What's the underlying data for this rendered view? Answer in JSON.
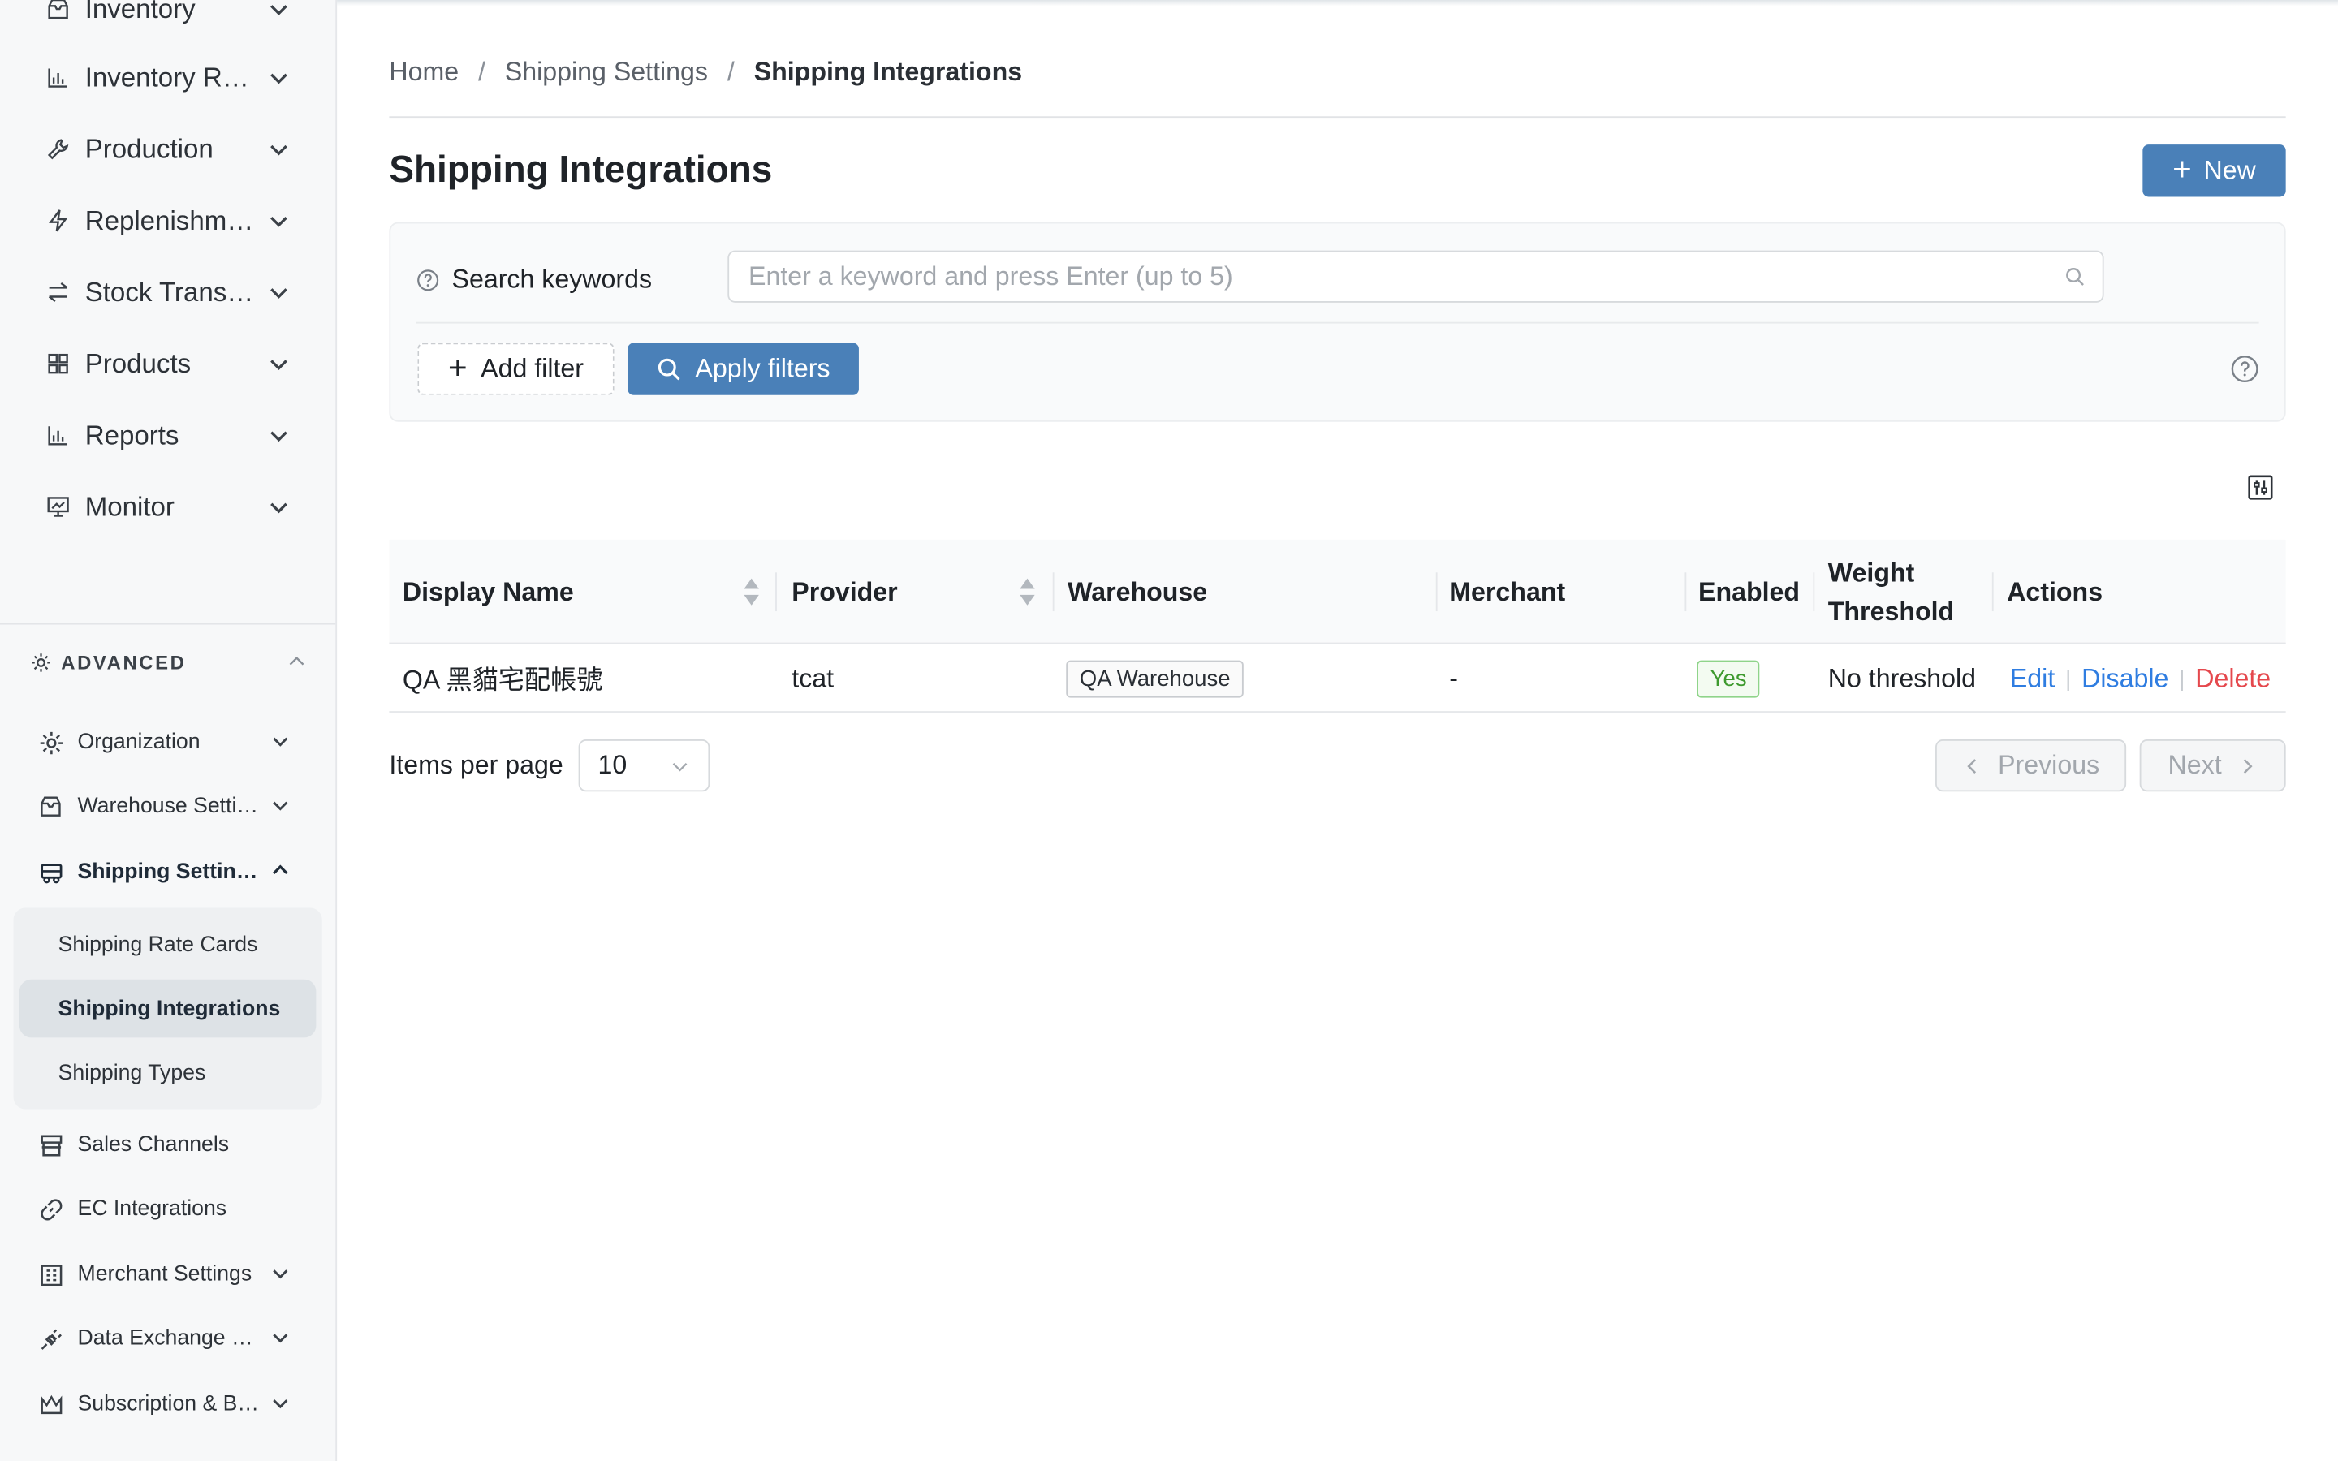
{
  "sidebar": {
    "top_items": [
      {
        "label": "Inventory",
        "icon": "inbox-icon"
      },
      {
        "label": "Inventory Reports",
        "icon": "bar-chart-icon"
      },
      {
        "label": "Production",
        "icon": "wrench-icon"
      },
      {
        "label": "Replenishment",
        "icon": "lightning-icon"
      },
      {
        "label": "Stock Transfers",
        "icon": "transfer-icon"
      },
      {
        "label": "Products",
        "icon": "grid-icon"
      },
      {
        "label": "Reports",
        "icon": "bar-chart-icon"
      },
      {
        "label": "Monitor",
        "icon": "monitor-icon"
      }
    ],
    "advanced_label": "ADVANCED",
    "advanced_items": [
      {
        "label": "Organization",
        "icon": "gear-icon"
      },
      {
        "label": "Warehouse Settings",
        "icon": "inbox-icon"
      },
      {
        "label": "Shipping Settings",
        "icon": "truck-icon"
      },
      {
        "label": "Sales Channels",
        "icon": "store-icon"
      },
      {
        "label": "EC Integrations",
        "icon": "link-icon"
      },
      {
        "label": "Merchant Settings",
        "icon": "merchant-icon"
      },
      {
        "label": "Data Exchange Settings",
        "icon": "plug-icon"
      },
      {
        "label": "Subscription & Billing",
        "icon": "crown-icon"
      }
    ],
    "shipping_submenu": [
      {
        "label": "Shipping Rate Cards"
      },
      {
        "label": "Shipping Integrations"
      },
      {
        "label": "Shipping Types"
      }
    ]
  },
  "breadcrumb": {
    "home": "Home",
    "parent": "Shipping Settings",
    "current": "Shipping Integrations",
    "separator": "/"
  },
  "page": {
    "title": "Shipping Integrations",
    "new_button": "New"
  },
  "filters": {
    "search_label": "Search keywords",
    "search_placeholder": "Enter a keyword and press Enter (up to 5)",
    "add_filter": "Add filter",
    "apply_filters": "Apply filters"
  },
  "table": {
    "headers": {
      "display_name": "Display Name",
      "provider": "Provider",
      "warehouse": "Warehouse",
      "merchant": "Merchant",
      "enabled": "Enabled",
      "weight_threshold_1": "Weight",
      "weight_threshold_2": "Threshold",
      "actions": "Actions"
    },
    "rows": [
      {
        "display_name": "QA 黑貓宅配帳號",
        "provider": "tcat",
        "warehouse": "QA Warehouse",
        "merchant": "-",
        "enabled": "Yes",
        "weight_threshold": "No threshold",
        "actions": {
          "edit": "Edit",
          "disable": "Disable",
          "delete": "Delete"
        }
      }
    ]
  },
  "pagination": {
    "items_per_page_label": "Items per page",
    "items_per_page_value": "10",
    "previous": "Previous",
    "next": "Next"
  },
  "colors": {
    "primary": "#4a80b8",
    "link": "#2f7de1",
    "danger": "#e5484d",
    "success": "#3e9a2f"
  }
}
